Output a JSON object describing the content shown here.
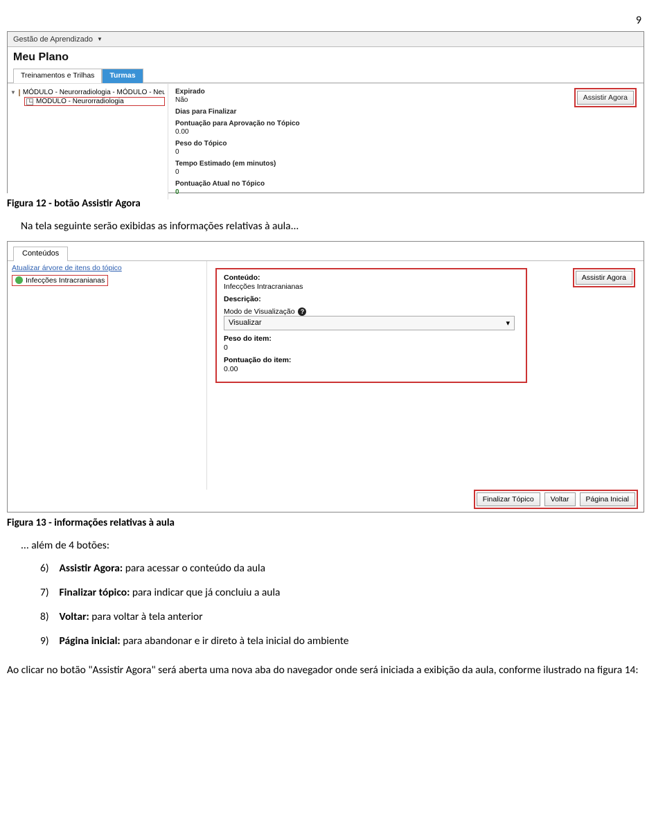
{
  "page_number": "9",
  "s1": {
    "menu": "Gestão de Aprendizado",
    "title": "Meu Plano",
    "tab1": "Treinamentos e Trilhas",
    "tab2": "Turmas",
    "tree_root": "MÓDULO - Neurorradiologia - MÓDULO - Neuror",
    "tree_child": "MÓDULO - Neurorradiologia",
    "f_expirado_lab": "Expirado",
    "f_expirado_val": "Não",
    "f_dias_lab": "Dias para Finalizar",
    "f_pont_aprov_lab": "Pontuação para Aprovação no Tópico",
    "f_pont_aprov_val": "0.00",
    "f_peso_lab": "Peso do Tópico",
    "f_peso_val": "0",
    "f_tempo_lab": "Tempo Estimado (em minutos)",
    "f_tempo_val": "0",
    "f_pont_atual_lab": "Pontuação Atual no Tópico",
    "f_pont_atual_val": "0",
    "btn_assistir": "Assistir Agora"
  },
  "caption1": "Figura 12 - botão Assistir Agora",
  "text1": "Na tela seguinte serão exibidas as informações relativas à aula...",
  "s2": {
    "tab": "Conteúdos",
    "link": "Atualizar árvore de itens do tópico",
    "tree_item": "Infecções Intracranianas",
    "f_conteudo_lab": "Conteúdo:",
    "f_conteudo_val": "Infecções Intracranianas",
    "f_descricao_lab": "Descrição:",
    "f_modo_lab": "Modo de Visualização",
    "select_val": "Visualizar",
    "f_peso_lab": "Peso do item:",
    "f_peso_val": "0",
    "f_pont_lab": "Pontuação do item:",
    "f_pont_val": "0.00",
    "btn_assistir": "Assistir Agora",
    "btn_finalizar": "Finalizar Tópico",
    "btn_voltar": "Voltar",
    "btn_pagina": "Página Inicial"
  },
  "caption2": "Figura 13 - informações relativas à aula",
  "list_intro": "... além de 4 botões:",
  "list": [
    {
      "n": "6)",
      "b": "Assistir Agora:",
      "t": " para acessar o conteúdo da aula"
    },
    {
      "n": "7)",
      "b": "Finalizar tópico:",
      "t": " para indicar que já concluiu a aula"
    },
    {
      "n": "8)",
      "b": "Voltar:",
      "t": " para voltar à tela anterior"
    },
    {
      "n": "9)",
      "b": "Página inicial:",
      "t": " para abandonar e ir direto à tela inicial do ambiente"
    }
  ],
  "closing": "Ao clicar no botão \"Assistir Agora\" será aberta uma nova aba do navegador onde será iniciada a exibição da aula, conforme ilustrado na figura 14:"
}
